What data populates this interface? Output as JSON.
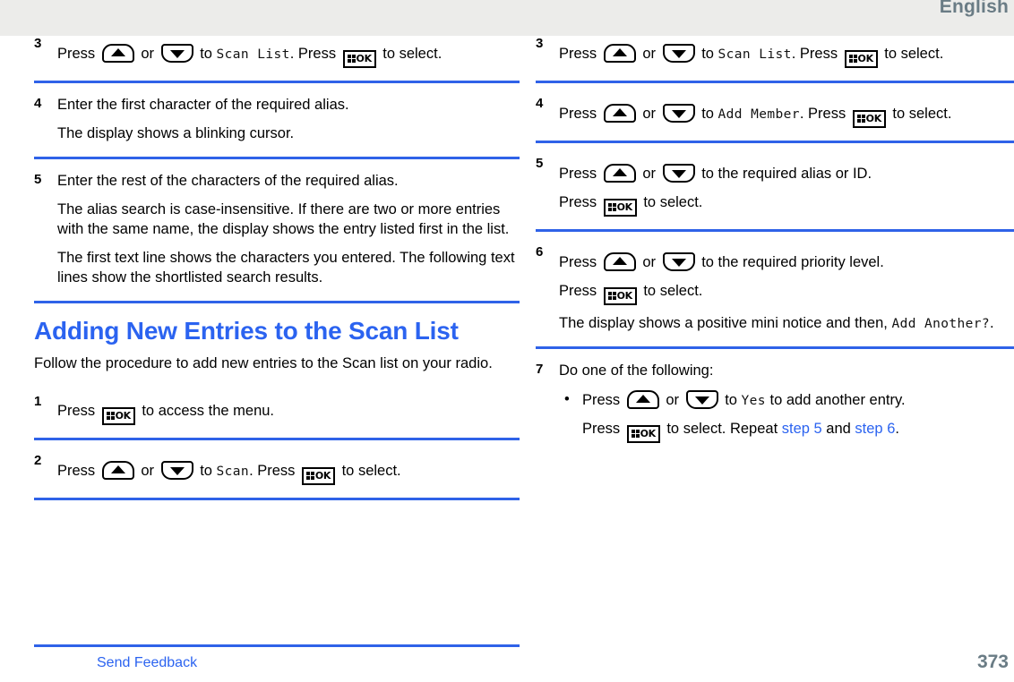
{
  "header": {
    "language": "English",
    "band_color": "#ececea",
    "text_color": "#6a7c85"
  },
  "colors": {
    "rule": "#2f62e8",
    "heading": "#2b63f0",
    "link": "#2b63f0",
    "page_number": "#6a7c85"
  },
  "left_column": {
    "steps": [
      {
        "number": "3",
        "lines": [
          {
            "segments": [
              {
                "t": "text",
                "v": "Press "
              },
              {
                "t": "btn-up"
              },
              {
                "t": "text",
                "v": " or "
              },
              {
                "t": "btn-down"
              },
              {
                "t": "text",
                "v": " to "
              },
              {
                "t": "lcd",
                "v": "Scan List"
              },
              {
                "t": "text",
                "v": ". Press "
              },
              {
                "t": "btn-ok"
              },
              {
                "t": "text",
                "v": " to select."
              }
            ]
          }
        ]
      },
      {
        "number": "4",
        "lines": [
          {
            "segments": [
              {
                "t": "text",
                "v": "Enter the first character of the required alias."
              }
            ]
          },
          {
            "segments": [
              {
                "t": "text",
                "v": "The display shows a blinking cursor."
              }
            ]
          }
        ]
      },
      {
        "number": "5",
        "lines": [
          {
            "segments": [
              {
                "t": "text",
                "v": "Enter the rest of the characters of the required alias."
              }
            ]
          },
          {
            "segments": [
              {
                "t": "text",
                "v": "The alias search is case-insensitive. If there are two or more entries with the same name, the display shows the entry listed first in the list."
              }
            ]
          },
          {
            "segments": [
              {
                "t": "text",
                "v": "The first text line shows the characters you entered. The following text lines show the shortlisted search results."
              }
            ]
          }
        ]
      }
    ],
    "section": {
      "title": "Adding New Entries to the Scan List",
      "intro": "Follow the procedure to add new entries to the Scan list on your radio."
    },
    "section_steps": [
      {
        "number": "1",
        "lines": [
          {
            "segments": [
              {
                "t": "text",
                "v": "Press "
              },
              {
                "t": "btn-ok"
              },
              {
                "t": "text",
                "v": " to access the menu."
              }
            ]
          }
        ]
      },
      {
        "number": "2",
        "lines": [
          {
            "segments": [
              {
                "t": "text",
                "v": "Press "
              },
              {
                "t": "btn-up"
              },
              {
                "t": "text",
                "v": " or "
              },
              {
                "t": "btn-down"
              },
              {
                "t": "text",
                "v": " to "
              },
              {
                "t": "lcd",
                "v": "Scan"
              },
              {
                "t": "text",
                "v": ". Press "
              },
              {
                "t": "btn-ok"
              },
              {
                "t": "text",
                "v": " to select."
              }
            ]
          }
        ]
      }
    ]
  },
  "right_column": {
    "steps": [
      {
        "number": "3",
        "lines": [
          {
            "segments": [
              {
                "t": "text",
                "v": "Press "
              },
              {
                "t": "btn-up"
              },
              {
                "t": "text",
                "v": " or "
              },
              {
                "t": "btn-down"
              },
              {
                "t": "text",
                "v": " to "
              },
              {
                "t": "lcd",
                "v": "Scan List"
              },
              {
                "t": "text",
                "v": ". Press "
              },
              {
                "t": "btn-ok"
              },
              {
                "t": "text",
                "v": " to select."
              }
            ]
          }
        ]
      },
      {
        "number": "4",
        "lines": [
          {
            "segments": [
              {
                "t": "text",
                "v": "Press "
              },
              {
                "t": "btn-up"
              },
              {
                "t": "text",
                "v": " or "
              },
              {
                "t": "btn-down"
              },
              {
                "t": "text",
                "v": " to "
              },
              {
                "t": "lcd",
                "v": "Add Member"
              },
              {
                "t": "text",
                "v": ". Press "
              },
              {
                "t": "btn-ok"
              },
              {
                "t": "text",
                "v": " to select."
              }
            ]
          }
        ]
      },
      {
        "number": "5",
        "lines": [
          {
            "segments": [
              {
                "t": "text",
                "v": "Press "
              },
              {
                "t": "btn-up"
              },
              {
                "t": "text",
                "v": " or "
              },
              {
                "t": "btn-down"
              },
              {
                "t": "text",
                "v": " to the required alias or ID."
              }
            ]
          },
          {
            "segments": [
              {
                "t": "text",
                "v": "Press "
              },
              {
                "t": "btn-ok"
              },
              {
                "t": "text",
                "v": " to select."
              }
            ]
          }
        ]
      },
      {
        "number": "6",
        "lines": [
          {
            "segments": [
              {
                "t": "text",
                "v": "Press "
              },
              {
                "t": "btn-up"
              },
              {
                "t": "text",
                "v": " or "
              },
              {
                "t": "btn-down"
              },
              {
                "t": "text",
                "v": " to the required priority level."
              }
            ]
          },
          {
            "segments": [
              {
                "t": "text",
                "v": "Press "
              },
              {
                "t": "btn-ok"
              },
              {
                "t": "text",
                "v": " to select."
              }
            ]
          },
          {
            "segments": [
              {
                "t": "text",
                "v": "The display shows a positive mini notice and then, "
              },
              {
                "t": "lcd",
                "v": "Add Another?"
              },
              {
                "t": "text",
                "v": "."
              }
            ]
          }
        ]
      },
      {
        "number": "7",
        "lines": [
          {
            "segments": [
              {
                "t": "text",
                "v": "Do one of the following:"
              }
            ]
          }
        ],
        "bullets": [
          {
            "sublines": [
              {
                "segments": [
                  {
                    "t": "text",
                    "v": "Press "
                  },
                  {
                    "t": "btn-up"
                  },
                  {
                    "t": "text",
                    "v": " or "
                  },
                  {
                    "t": "btn-down"
                  },
                  {
                    "t": "text",
                    "v": " to "
                  },
                  {
                    "t": "lcd",
                    "v": "Yes"
                  },
                  {
                    "t": "text",
                    "v": " to add another entry."
                  }
                ]
              },
              {
                "segments": [
                  {
                    "t": "text",
                    "v": "Press "
                  },
                  {
                    "t": "btn-ok"
                  },
                  {
                    "t": "text",
                    "v": " to select. Repeat "
                  },
                  {
                    "t": "link",
                    "v": "step 5"
                  },
                  {
                    "t": "text",
                    "v": " and "
                  },
                  {
                    "t": "link",
                    "v": "step 6"
                  },
                  {
                    "t": "text",
                    "v": "."
                  }
                ]
              }
            ]
          }
        ]
      }
    ]
  },
  "footer": {
    "feedback_label": "Send Feedback",
    "page_number": "373"
  }
}
